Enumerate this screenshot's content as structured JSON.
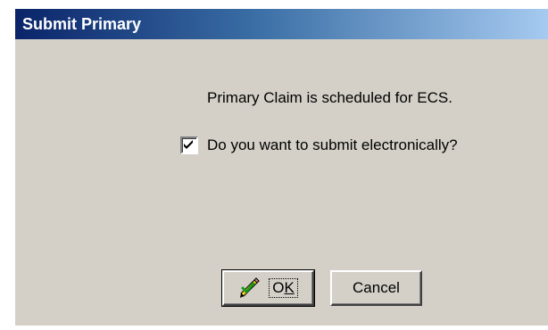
{
  "window": {
    "title": "Submit Primary"
  },
  "dialog": {
    "message": "Primary Claim is scheduled for ECS.",
    "checkbox_label": "Do you want to submit electronically?",
    "checkbox_checked": true
  },
  "buttons": {
    "ok_prefix": "O",
    "ok_accel": "K",
    "ok_icon": "pencil-check-icon",
    "cancel_label": "Cancel"
  },
  "colors": {
    "titlebar_start": "#0a246a",
    "titlebar_end": "#a6caf0",
    "dialog_background": "#d4d0c8"
  }
}
